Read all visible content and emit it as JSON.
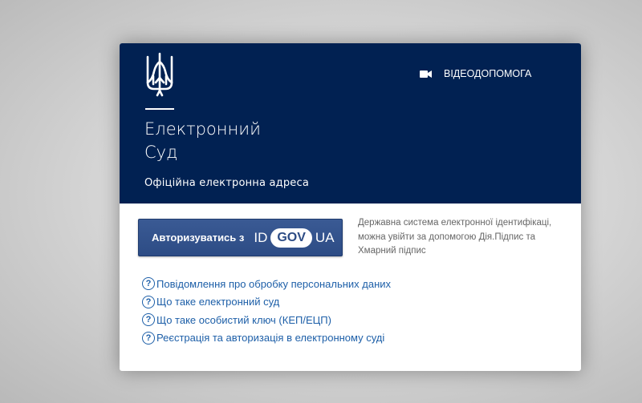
{
  "header": {
    "title_line1": "Електронний",
    "title_line2": "Суд",
    "subtitle": "Офіційна електронна адреса",
    "video_help_label": "ВІДЕОДОПОМОГА"
  },
  "auth": {
    "button_label": "Авторизуватись з",
    "logo_left": "ID",
    "logo_middle": "GOV",
    "logo_right": "UA",
    "description": "Державна система електронної ідентифікаці, можна увійти за допомогою Дія.Підпис та Хмарний підпис"
  },
  "links": [
    {
      "label": "Повідомлення про обробку персональних даних"
    },
    {
      "label": "Що таке електронний суд"
    },
    {
      "label": "Що таке особистий ключ (КЕП/ЕЦП)"
    },
    {
      "label": "Реєстрація та авторизація в електронному суді"
    }
  ],
  "icons": {
    "emblem": "trident-icon",
    "video": "video-camera-icon",
    "help": "question-circle-icon"
  },
  "colors": {
    "header_bg": "#012152",
    "button_bg": "#2d4c85",
    "link": "#1d5fa8",
    "description_text": "#666666"
  }
}
